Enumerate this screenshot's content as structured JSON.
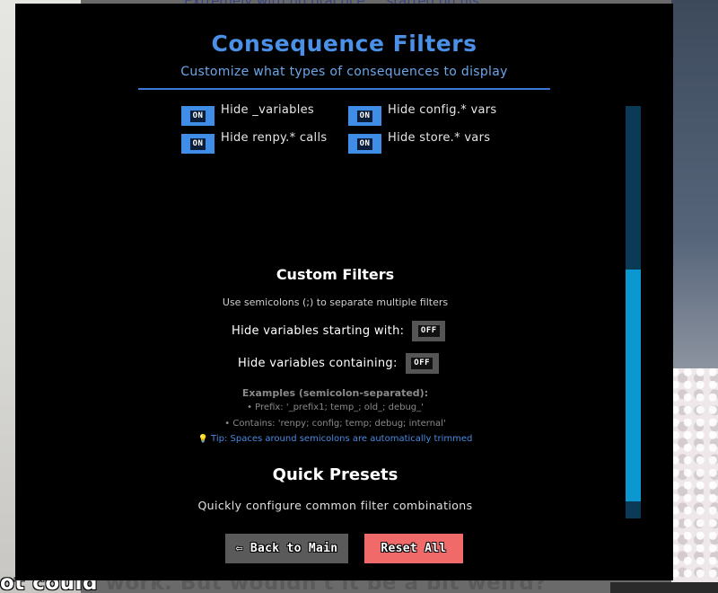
{
  "background": {
    "top_dialogue": "Extremely with no practice ... started on his",
    "dialogue_lead": "ot could",
    "dialogue_rest": " work. But wouldn't it be a bit weird?"
  },
  "dialog": {
    "title": "Consequence Filters",
    "subtitle": "Customize what types of consequences to display",
    "toggles": [
      {
        "label": "Hide _variables",
        "state": "ON"
      },
      {
        "label": "Hide config.* vars",
        "state": "ON"
      },
      {
        "label": "Hide renpy.* calls",
        "state": "ON"
      },
      {
        "label": "Hide store.* vars",
        "state": "ON"
      }
    ],
    "custom": {
      "title": "Custom Filters",
      "hint": "Use semicolons (;) to separate multiple filters",
      "starts_with_label": "Hide variables starting with:",
      "starts_with_state": "OFF",
      "contains_label": "Hide variables containing:",
      "contains_state": "OFF",
      "examples_title": "Examples (semicolon-separated):",
      "prefix_example": "• Prefix: '_prefix1; temp_; old_; debug_'",
      "contains_example": "• Contains: 'renpy; config; temp; debug; internal'",
      "tip_icon": "💡",
      "tip": "Tip: Spaces around semicolons are automatically trimmed"
    },
    "presets": {
      "title": "Quick Presets",
      "subtitle": "Quickly configure common filter combinations"
    },
    "buttons": {
      "back": "⇦ Back to Main",
      "reset": "Reset All"
    },
    "scrollbar": {
      "position": 0.4
    }
  },
  "colors": {
    "accent": "#4a90e6",
    "toggle_on": "#3f8de6",
    "toggle_off": "#555555",
    "reset": "#f06a6a",
    "scroll_track": "#0a3a55",
    "scroll_thumb": "#0b97cf"
  }
}
